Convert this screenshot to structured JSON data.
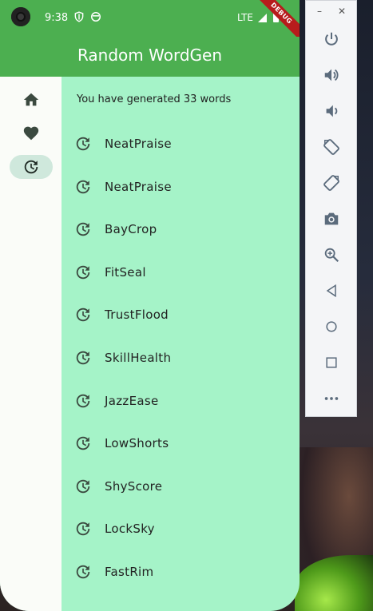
{
  "status_bar": {
    "time": "9:38",
    "network": "LTE",
    "debug_banner": "DEBUG"
  },
  "app_bar": {
    "title": "Random WordGen"
  },
  "nav_rail": {
    "items": [
      {
        "name": "home",
        "icon": "home-icon",
        "selected": false
      },
      {
        "name": "favorites",
        "icon": "heart-icon",
        "selected": false
      },
      {
        "name": "history",
        "icon": "history-icon",
        "selected": true
      }
    ]
  },
  "history": {
    "header": "You have generated 33 words",
    "words": [
      "NeatPraise",
      "NeatPraise",
      "BayCrop",
      "FitSeal",
      "TrustFlood",
      "SkillHealth",
      "JazzEase",
      "LowShorts",
      "ShyScore",
      "LockSky",
      "FastRim"
    ]
  },
  "emulator_panel": {
    "window_controls": [
      "minimize-icon",
      "close-icon"
    ],
    "buttons": [
      "power-icon",
      "volume-up-icon",
      "volume-down-icon",
      "rotate-left-icon",
      "rotate-right-icon",
      "camera-icon",
      "zoom-icon",
      "back-icon",
      "home-circle-icon",
      "overview-icon",
      "more-icon"
    ]
  },
  "colors": {
    "app_bar": "#4caf50",
    "background": "#a5f3c8",
    "rail": "#fafcf8",
    "rail_selected": "#cfe8dc",
    "icon": "#3b4a40"
  }
}
